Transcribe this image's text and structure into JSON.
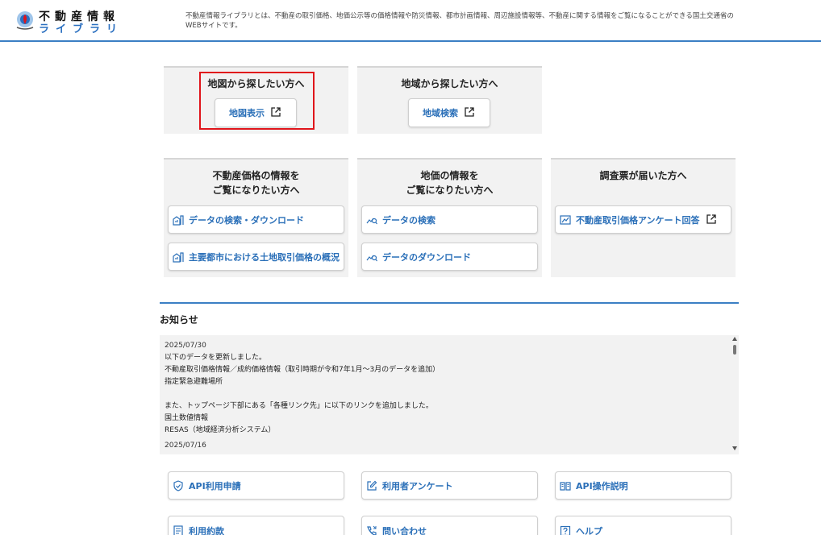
{
  "header": {
    "logo_line1": "不動産情報",
    "logo_line2": "ライブラリ",
    "description": "不動産情報ライブラリとは、不動産の取引価格、地価公示等の価格情報や防災情報、都市計画情報、周辺施設情報等、不動産に関する情報をご覧になることができる国土交通省のWEBサイトです。"
  },
  "search_panels": [
    {
      "title": "地図から探したい方へ",
      "button": "地図表示"
    },
    {
      "title": "地域から探したい方へ",
      "button": "地域検索"
    }
  ],
  "info_panels": [
    {
      "title": "不動産価格の情報を\nご覧になりたい方へ",
      "buttons": [
        "データの検索・ダウンロード",
        "主要都市における土地取引価格の概況"
      ]
    },
    {
      "title": "地価の情報を\nご覧になりたい方へ",
      "buttons": [
        "データの検索",
        "データのダウンロード"
      ]
    },
    {
      "title": "調査票が届いた方へ",
      "buttons": [
        "不動産取引価格アンケート回答"
      ]
    }
  ],
  "news": {
    "title": "お知らせ",
    "entries": [
      {
        "date": "2025/07/30",
        "lines": [
          "以下のデータを更新しました。",
          "不動産取引価格情報／成約価格情報（取引時期が令和7年1月～3月のデータを追加）",
          "指定緊急避難場所",
          "",
          "また、トップページ下部にある「各種リンク先」に以下のリンクを追加しました。",
          "国土数値情報",
          "RESAS（地域経済分析システム）"
        ]
      },
      {
        "date": "2025/07/16",
        "lines": []
      }
    ]
  },
  "links": {
    "row1": [
      "API利用申請",
      "利用者アンケート",
      "API操作説明"
    ],
    "row2": [
      "利用約款",
      "問い合わせ",
      "ヘルプ"
    ]
  },
  "colors": {
    "accent": "#3b7fc4",
    "link": "#2a6fb8",
    "highlight": "#e0151b",
    "panel": "#f2f2f2"
  }
}
